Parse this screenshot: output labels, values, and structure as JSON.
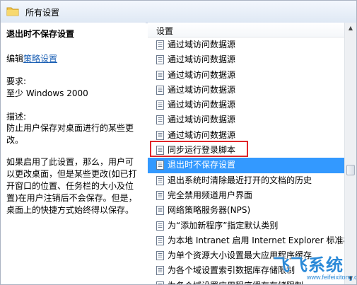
{
  "breadcrumb": {
    "title": "所有设置"
  },
  "left_pane": {
    "policy_title": "退出时不保存设置",
    "edit_prefix": "编辑",
    "edit_link": "策略设置",
    "requirements_label": "要求:",
    "requirements_value": "至少 Windows 2000",
    "description_label": "描述:",
    "description_text": "防止用户保存对桌面进行的某些更改。",
    "detail_text": "如果启用了此设置，那么，用户可以更改桌面，但是某些更改(如已打开窗口的位置、任务栏的大小及位置)在用户注销后不会保存。但是，桌面上的快捷方式始终得以保存。"
  },
  "list": {
    "header": "设置",
    "items": [
      {
        "label": "通过域访问数据源"
      },
      {
        "label": "通过域访问数据源"
      },
      {
        "label": "通过域访问数据源"
      },
      {
        "label": "通过域访问数据源"
      },
      {
        "label": "通过域访问数据源"
      },
      {
        "label": "通过域访问数据源"
      },
      {
        "label": "通过域访问数据源"
      },
      {
        "label": "同步运行登录脚本"
      },
      {
        "label": "退出时不保存设置",
        "selected": true
      },
      {
        "label": "退出系统时清除最近打开的文档的历史"
      },
      {
        "label": "完全禁用频道用户界面"
      },
      {
        "label": "网络策略服务器(NPS)"
      },
      {
        "label": "为“添加新程序”指定默认类别"
      },
      {
        "label": "为本地 Intranet 启用 Internet Explorer 标准模式"
      },
      {
        "label": "为单个资源大小设置最大应用程序缓存"
      },
      {
        "label": "为各个域设置索引数据库存储限制"
      },
      {
        "label": "为各个域设置应用程序缓存存储限制"
      }
    ]
  },
  "watermark": {
    "logo_text": "飞飞系统",
    "url": "www.feifeixitong.com"
  },
  "colors": {
    "selection": "#3399ff",
    "highlight_box": "#e0262a",
    "link": "#1a5fb4",
    "watermark": "#2b8ad8"
  }
}
